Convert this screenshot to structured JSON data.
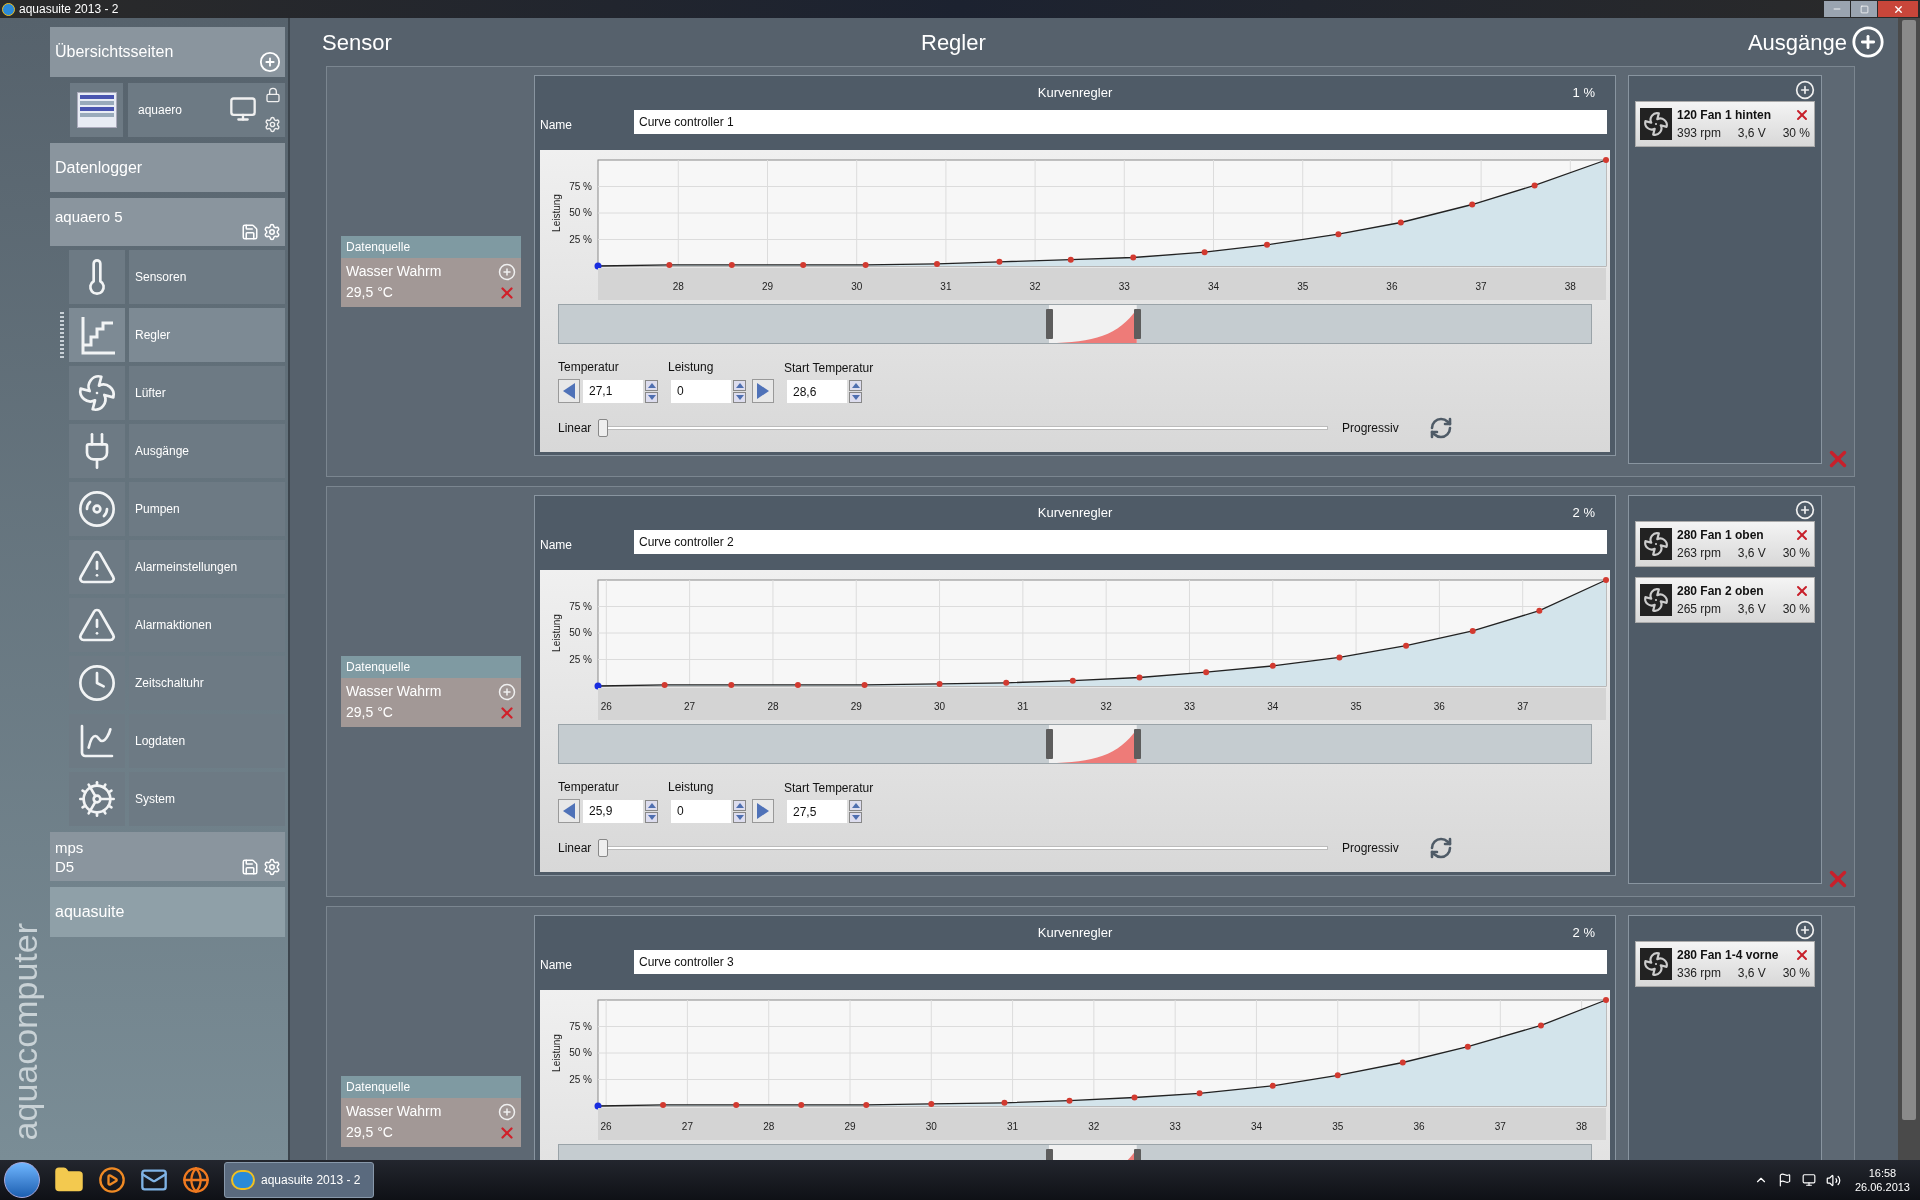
{
  "window": {
    "title": "aquasuite 2013 - 2"
  },
  "sidebar": {
    "brand": "aquacomputer",
    "overview": {
      "title": "Übersichtsseiten",
      "pages": [
        {
          "label": "aquaero"
        }
      ]
    },
    "datalogger": {
      "title": "Datenlogger"
    },
    "device": {
      "title": "aquaero 5",
      "items": [
        {
          "label": "Sensoren",
          "selected": false
        },
        {
          "label": "Regler",
          "selected": true
        },
        {
          "label": "Lüfter",
          "selected": false
        },
        {
          "label": "Ausgänge",
          "selected": false
        },
        {
          "label": "Pumpen",
          "selected": false
        },
        {
          "label": "Alarmeinstellungen",
          "selected": false
        },
        {
          "label": "Alarmaktionen",
          "selected": false
        },
        {
          "label": "Zeitschaltuhr",
          "selected": false
        },
        {
          "label": "Logdaten",
          "selected": false
        },
        {
          "label": "System",
          "selected": false
        }
      ]
    },
    "device2": {
      "title_lines": [
        "mps",
        "D5"
      ]
    },
    "app": {
      "title": "aquasuite"
    }
  },
  "headers": {
    "sensor": "Sensor",
    "controller": "Regler",
    "outputs": "Ausgänge"
  },
  "controllers": [
    {
      "source": {
        "caption": "Datenquelle",
        "name": "Wasser Wahrm",
        "value": "29,5 °C"
      },
      "type_label": "Kurvenregler",
      "output_percent": "1 %",
      "name_label": "Name",
      "name": "Curve controller 1",
      "chart_data": {
        "type": "area",
        "ylabel": "Leistung",
        "x": [
          27.1,
          27.9,
          28.6,
          29.4,
          30.1,
          30.9,
          31.6,
          32.4,
          33.1,
          33.9,
          34.6,
          35.4,
          36.1,
          36.9,
          37.6,
          38.4
        ],
        "values": [
          0,
          1,
          1,
          1,
          1,
          2,
          4,
          6,
          8,
          13,
          20,
          30,
          41,
          58,
          76,
          100
        ],
        "xlim": [
          27.1,
          38.4
        ],
        "ylim": [
          0,
          100
        ],
        "grid": true,
        "xticks": [
          28,
          29,
          30,
          31,
          32,
          33,
          34,
          35,
          36,
          37,
          38
        ],
        "yticks": [
          {
            "value": 25,
            "label": "25 %"
          },
          {
            "value": 50,
            "label": "50 %"
          },
          {
            "value": 75,
            "label": "75 %"
          }
        ]
      },
      "fields": [
        {
          "label": "Temperatur",
          "value": "27,1"
        },
        {
          "label": "Leistung",
          "value": "0"
        },
        {
          "label": "Start Temperatur",
          "value": "28,6"
        }
      ],
      "curve": {
        "left": "Linear",
        "right": "Progressiv",
        "level": 0
      },
      "outputs": [
        {
          "name": "120 Fan 1 hinten",
          "rpm": "393 rpm",
          "voltage": "3,6 V",
          "percent": "30 %"
        }
      ]
    },
    {
      "source": {
        "caption": "Datenquelle",
        "name": "Wasser Wahrm",
        "value": "29,5 °C"
      },
      "type_label": "Kurvenregler",
      "output_percent": "2 %",
      "name_label": "Name",
      "name": "Curve controller 2",
      "chart_data": {
        "type": "area",
        "ylabel": "Leistung",
        "x": [
          25.9,
          26.7,
          27.5,
          28.3,
          29.1,
          30.0,
          30.8,
          31.6,
          32.4,
          33.2,
          34.0,
          34.8,
          35.6,
          36.4,
          37.2,
          38.0
        ],
        "values": [
          0,
          1,
          1,
          1,
          1,
          2,
          3,
          5,
          8,
          13,
          19,
          27,
          38,
          52,
          71,
          100
        ],
        "xlim": [
          25.9,
          38.0
        ],
        "ylim": [
          0,
          100
        ],
        "grid": true,
        "xticks": [
          26,
          27,
          28,
          29,
          30,
          31,
          32,
          33,
          34,
          35,
          36,
          37
        ],
        "yticks": [
          {
            "value": 25,
            "label": "25 %"
          },
          {
            "value": 50,
            "label": "50 %"
          },
          {
            "value": 75,
            "label": "75 %"
          }
        ]
      },
      "fields": [
        {
          "label": "Temperatur",
          "value": "25,9"
        },
        {
          "label": "Leistung",
          "value": "0"
        },
        {
          "label": "Start Temperatur",
          "value": "27,5"
        }
      ],
      "curve": {
        "left": "Linear",
        "right": "Progressiv",
        "level": 0
      },
      "outputs": [
        {
          "name": "280 Fan 1 oben",
          "rpm": "263 rpm",
          "voltage": "3,6 V",
          "percent": "30 %"
        },
        {
          "name": "280 Fan 2 oben",
          "rpm": "265 rpm",
          "voltage": "3,6 V",
          "percent": "30 %"
        }
      ]
    },
    {
      "source": {
        "caption": "Datenquelle",
        "name": "Wasser Wahrm",
        "value": "29,5 °C"
      },
      "type_label": "Kurvenregler",
      "output_percent": "2 %",
      "name_label": "Name",
      "name": "Curve controller 3",
      "chart_data": {
        "type": "area",
        "ylabel": "Leistung",
        "x": [
          25.9,
          26.7,
          27.6,
          28.4,
          29.2,
          30.0,
          30.9,
          31.7,
          32.5,
          33.3,
          34.2,
          35.0,
          35.8,
          36.6,
          37.5,
          38.3
        ],
        "values": [
          0,
          1,
          1,
          1,
          1,
          2,
          3,
          5,
          8,
          12,
          19,
          29,
          41,
          56,
          76,
          100
        ],
        "xlim": [
          25.9,
          38.3
        ],
        "ylim": [
          0,
          100
        ],
        "grid": true,
        "xticks": [
          26,
          27,
          28,
          29,
          30,
          31,
          32,
          33,
          34,
          35,
          36,
          37,
          38
        ],
        "yticks": [
          {
            "value": 25,
            "label": "25 %"
          },
          {
            "value": 50,
            "label": "50 %"
          },
          {
            "value": 75,
            "label": "75 %"
          }
        ]
      },
      "outputs": [
        {
          "name": "280 Fan 1-4 vorne",
          "rpm": "336 rpm",
          "voltage": "3,6 V",
          "percent": "30 %"
        }
      ]
    }
  ],
  "taskbar": {
    "active_task": "aquasuite 2013 - 2",
    "time": "16:58",
    "date": "26.06.2013"
  }
}
